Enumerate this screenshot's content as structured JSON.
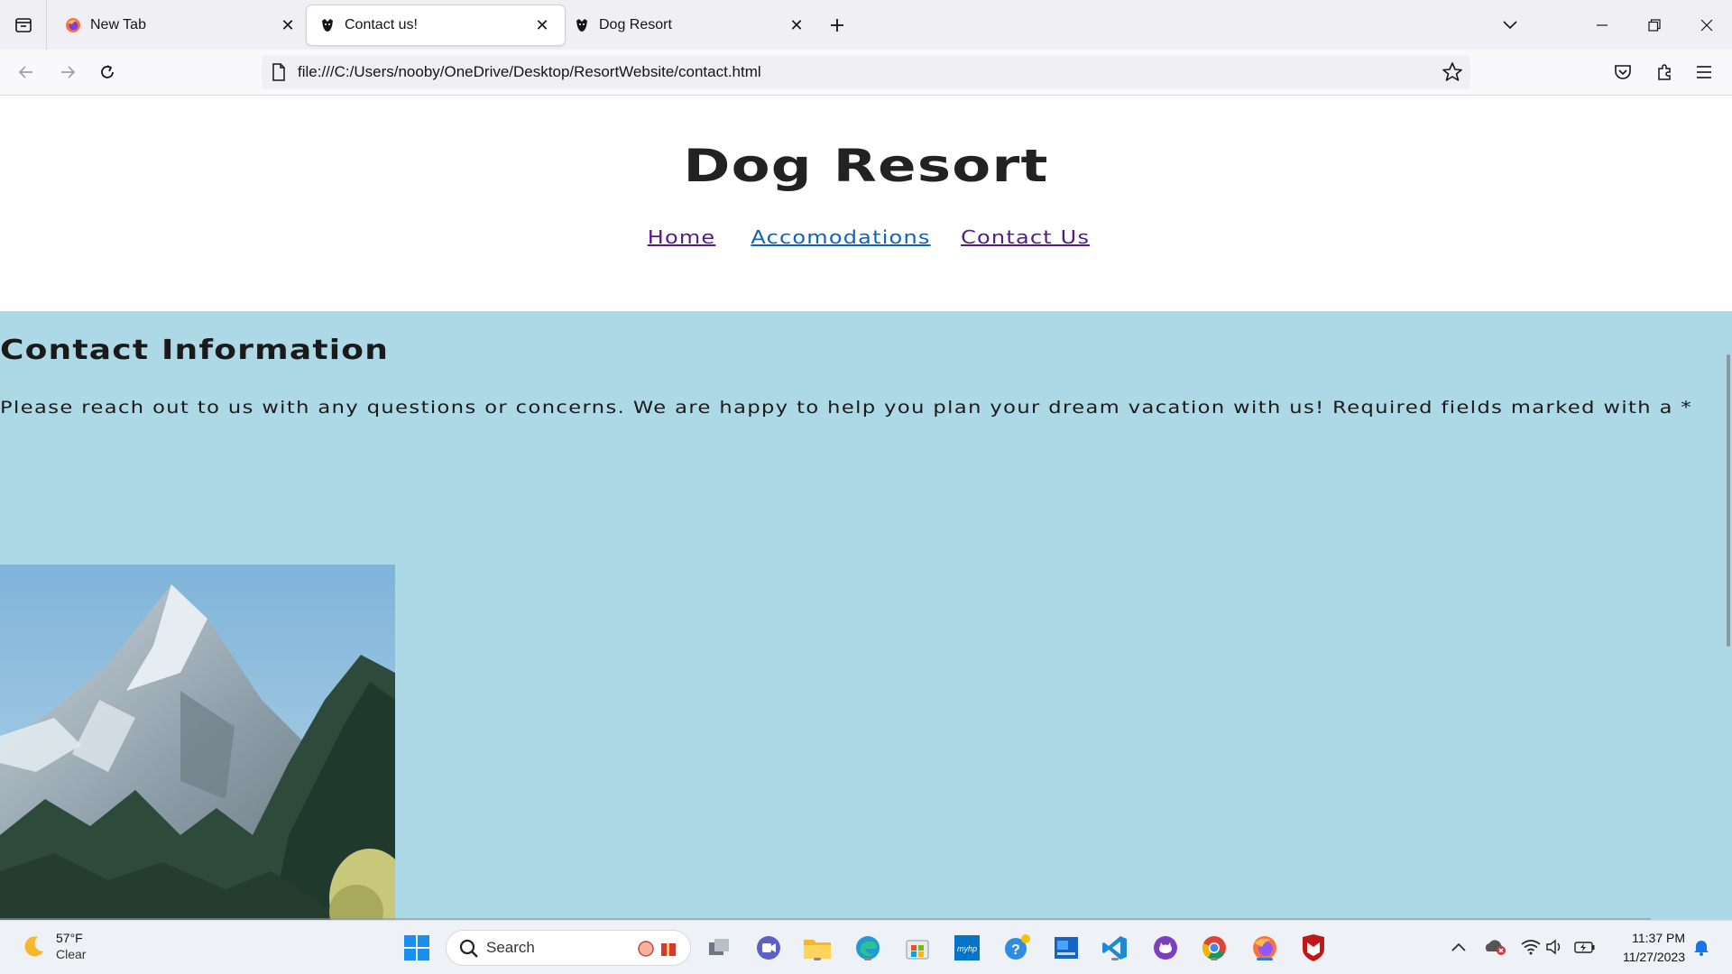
{
  "browser": {
    "tabs": [
      {
        "title": "New Tab",
        "active": false
      },
      {
        "title": "Contact us!",
        "active": true
      },
      {
        "title": "Dog Resort",
        "active": false
      }
    ],
    "url": "file:///C:/Users/nooby/OneDrive/Desktop/ResortWebsite/contact.html"
  },
  "site": {
    "title": "Dog Resort",
    "nav": [
      "Home",
      "Accomodations",
      "Contact Us"
    ],
    "section_heading": "Contact Information",
    "intro": "Please reach out to us with any questions or concerns. We are happy to help you plan your dream vacation with us! Required fields marked with a *",
    "background_color": "#add8e6"
  },
  "taskbar": {
    "weather_temp": "57°F",
    "weather_condition": "Clear",
    "search_placeholder": "Search",
    "time": "11:37 PM",
    "date": "11/27/2023"
  }
}
